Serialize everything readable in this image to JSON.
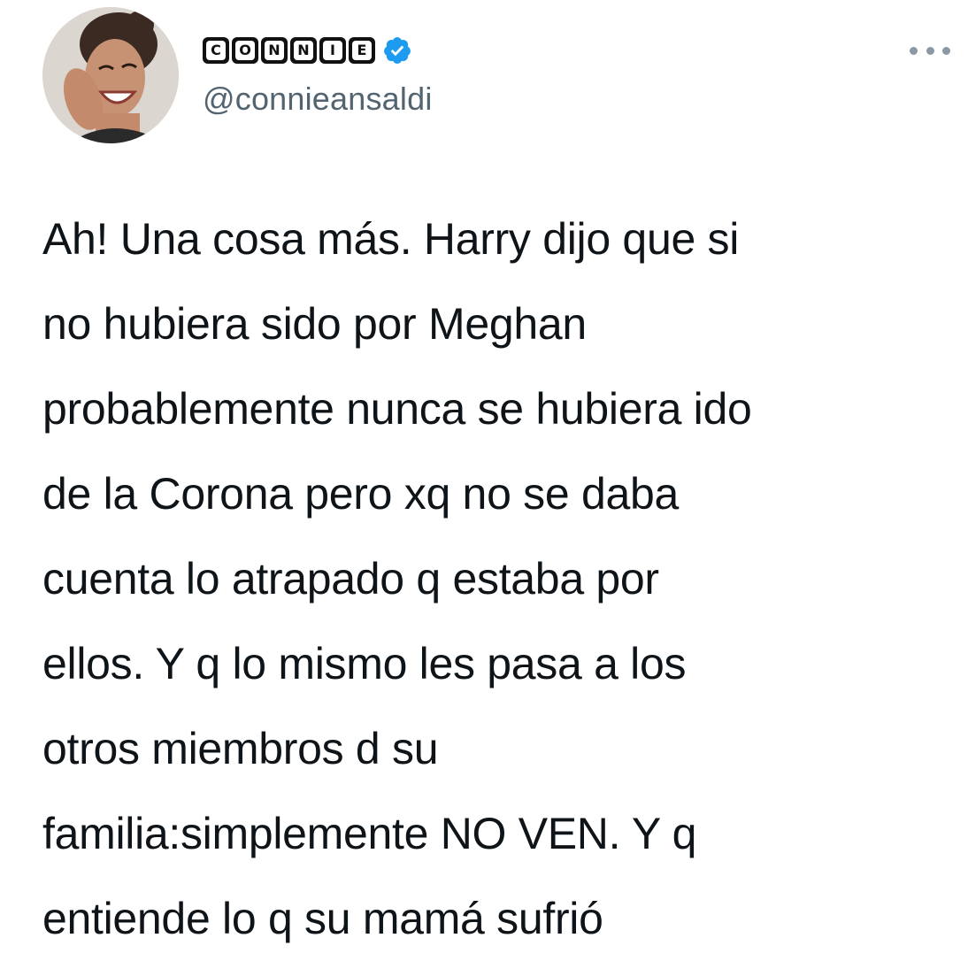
{
  "author": {
    "display_name_tiles": [
      "C",
      "O",
      "N",
      "N",
      "I",
      "E"
    ],
    "handle": "@connieansaldi",
    "verified": true,
    "avatar_icon": "profile-photo",
    "verified_icon": "verified-badge-icon"
  },
  "tweet": {
    "lines": [
      "Ah! Una cosa más. Harry dijo que si",
      "no hubiera sido por Meghan",
      "probablemente nunca se hubiera ido",
      "de la Corona pero xq no se daba",
      "cuenta lo atrapado q estaba por",
      "ellos. Y q lo mismo les pasa a los",
      "otros miembros d su",
      "familia:simplemente NO VEN. Y q",
      "entiende lo q su mamá sufrió"
    ]
  },
  "menu": {
    "icon": "more-options-icon"
  },
  "colors": {
    "text": "#0f1419",
    "secondary": "#536471",
    "verified": "#1d9bf0",
    "tile": "#111111"
  }
}
